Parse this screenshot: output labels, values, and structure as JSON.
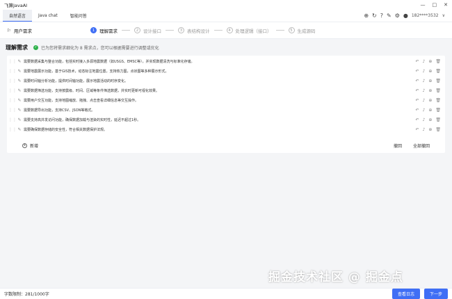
{
  "app": {
    "title": "飞算JavaAI"
  },
  "window_controls": [
    "—",
    "□",
    "✕"
  ],
  "tabs": [
    {
      "label": "自然语言",
      "active": true
    },
    {
      "label": "Java chat",
      "active": false
    },
    {
      "label": "智能问答",
      "active": false
    }
  ],
  "header_right": {
    "icons": [
      "add-circle-icon",
      "refresh-icon",
      "help-icon",
      "edit-icon",
      "settings-icon"
    ],
    "user": "182****3532",
    "user_dropdown": "∨"
  },
  "stepbar": {
    "requirement_label": "用户需求",
    "steps": [
      {
        "num": "1",
        "label": "理解需求",
        "active": true
      },
      {
        "num": "2",
        "label": "设计接口",
        "active": false
      },
      {
        "num": "3",
        "label": "表结构设计",
        "active": false
      },
      {
        "num": "4",
        "label": "处理逻辑（接口）",
        "active": false
      },
      {
        "num": "5",
        "label": "生成源码",
        "active": false
      }
    ]
  },
  "understand": {
    "title": "理解需求",
    "hint": "已为您将需求细化为 8 需求点，您可以根据需要进行调整或优化"
  },
  "requirements": [
    "需要数据采集与整合功能，包括实时接入多源地震数据（如USGS、EMSC等），并实现数据清洗与标准化存储。",
    "需要地震展示功能，基于GIS技术，动态标注地震位置，支持热力图，点状图等多种展示形式。",
    "需要时间轴分析功能，提供时间轴功能，展示地震活动的时序变化。",
    "需要数据筛选功能，支持按震级、时间、区域等条件筛选数据，并实时更新可视化效果。",
    "需要用户交互功能，支持地图缩放、拖拽、点击查看详细信息等交互操作。",
    "需要数据导出功能，支持CSV、JSON等格式。",
    "需要支持高并发访问功能，确保数据加载与渲染的实时性，延迟不超过1秒。",
    "需要确保数据存储的安全性，符合相关数据保护法规。"
  ],
  "panel_footer": {
    "add_label": "新增",
    "undo_label": "撤回",
    "undo_all_label": "全部撤回"
  },
  "bottom": {
    "char_limit": "字数限制：281/1000字",
    "btn_view": "查看日志",
    "btn_next": "下一步"
  },
  "watermark": "掘金技术社区 @ 掘金点"
}
